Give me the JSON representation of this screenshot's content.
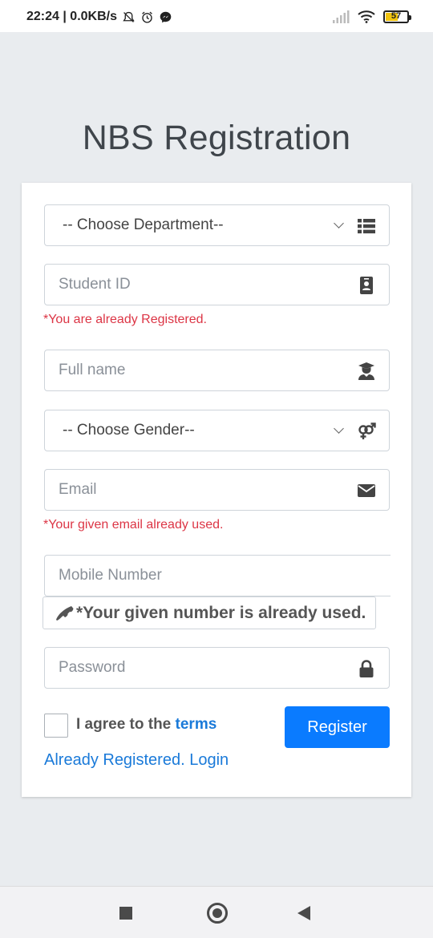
{
  "status_bar": {
    "time_speed": "22:24 | 0.0KB/s",
    "battery": "57"
  },
  "title": "NBS Registration",
  "form": {
    "department_select": "-- Choose Department--",
    "student_id_placeholder": "Student ID",
    "student_id_error": "*You are already Registered.",
    "full_name_placeholder": "Full name",
    "gender_select": "-- Choose Gender--",
    "email_placeholder": "Email",
    "email_error": "*Your given email already used.",
    "mobile_placeholder": "Mobile Number",
    "mobile_error": "*Your given number is already used.",
    "password_placeholder": "Password",
    "agree_text": "I agree to the ",
    "terms_link": "terms",
    "register_button": "Register",
    "login_link": "Already Registered. Login"
  },
  "icons": {
    "department": "list-icon",
    "student_id": "id-card-icon",
    "full_name": "user-graduate-icon",
    "gender": "venus-mars-icon",
    "email": "envelope-icon",
    "mobile": "phone-icon",
    "password": "lock-icon"
  },
  "colors": {
    "primary": "#0a7bff",
    "error": "#dc3545",
    "link": "#1a7ad9"
  }
}
